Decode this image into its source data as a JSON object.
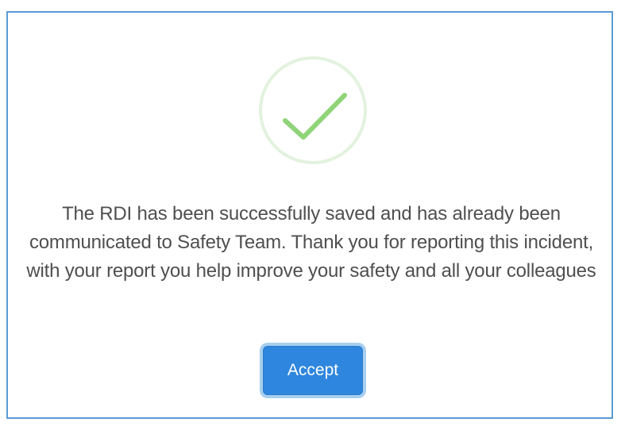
{
  "dialog": {
    "icon": "success-check-icon",
    "message": "The RDI has been successfully saved and has already been communicated to Safety Team. Thank you for reporting this incident, with your report you help improve your safety and all your colleagues",
    "accept_label": "Accept"
  },
  "colors": {
    "border": "#5b9bd5",
    "check": "#8fd479",
    "icon_ring": "#e2f2de",
    "button": "#2e86de",
    "button_focus_ring": "#a7cfee",
    "text": "#4f4f4f"
  }
}
